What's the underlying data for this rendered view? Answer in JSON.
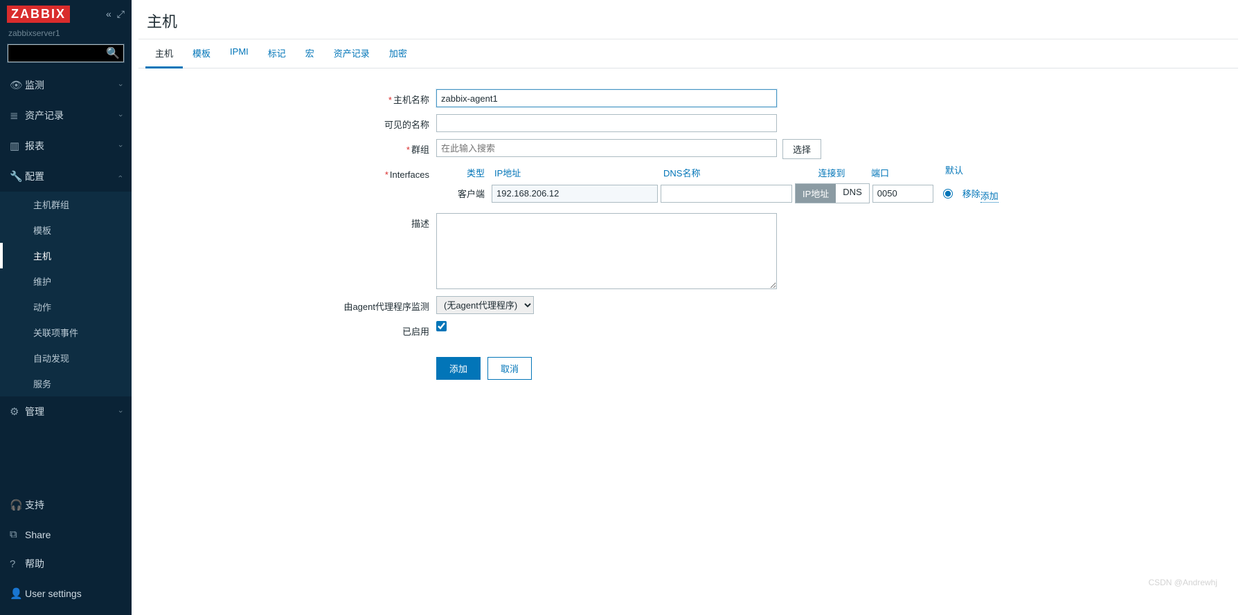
{
  "brand": "ZABBIX",
  "server_name": "zabbixserver1",
  "search_placeholder": "",
  "nav": [
    {
      "icon": "👁",
      "label": "监测",
      "expanded": false
    },
    {
      "icon": "≣",
      "label": "资产记录",
      "expanded": false
    },
    {
      "icon": "▥",
      "label": "报表",
      "expanded": false
    },
    {
      "icon": "🔧",
      "label": "配置",
      "expanded": true,
      "sub": [
        {
          "label": "主机群组"
        },
        {
          "label": "模板"
        },
        {
          "label": "主机",
          "active": true
        },
        {
          "label": "维护"
        },
        {
          "label": "动作"
        },
        {
          "label": "关联项事件"
        },
        {
          "label": "自动发现"
        },
        {
          "label": "服务"
        }
      ]
    },
    {
      "icon": "⚙",
      "label": "管理",
      "expanded": false
    }
  ],
  "footer_nav": [
    {
      "icon": "🎧",
      "label": "支持"
    },
    {
      "icon": "⧉",
      "label": "Share"
    },
    {
      "icon": "?",
      "label": "帮助"
    },
    {
      "icon": "👤",
      "label": "User settings"
    }
  ],
  "page_title": "主机",
  "tabs": [
    {
      "label": "主机",
      "active": true
    },
    {
      "label": "模板"
    },
    {
      "label": "IPMI"
    },
    {
      "label": "标记"
    },
    {
      "label": "宏"
    },
    {
      "label": "资产记录"
    },
    {
      "label": "加密"
    }
  ],
  "form": {
    "hostname_label": "主机名称",
    "hostname_value": "zabbix-agent1",
    "visiblename_label": "可见的名称",
    "visiblename_value": "",
    "groups_label": "群组",
    "groups_placeholder": "在此输入搜索",
    "groups_select_btn": "选择",
    "interfaces_label": "Interfaces",
    "iface_headers": {
      "type": "类型",
      "ip": "IP地址",
      "dns": "DNS名称",
      "conn": "连接到",
      "port": "端口",
      "default": "默认"
    },
    "iface_row": {
      "type_label": "客户端",
      "ip": "192.168.206.12",
      "dns": "",
      "conn_ip": "IP地址",
      "conn_dns": "DNS",
      "port": "0050",
      "remove": "移除"
    },
    "add_link": "添加",
    "desc_label": "描述",
    "desc_value": "",
    "proxy_label": "由agent代理程序监测",
    "proxy_value": "(无agent代理程序)",
    "enabled_label": "已启用",
    "submit": "添加",
    "cancel": "取消"
  },
  "watermark": "CSDN @Andrewhj"
}
